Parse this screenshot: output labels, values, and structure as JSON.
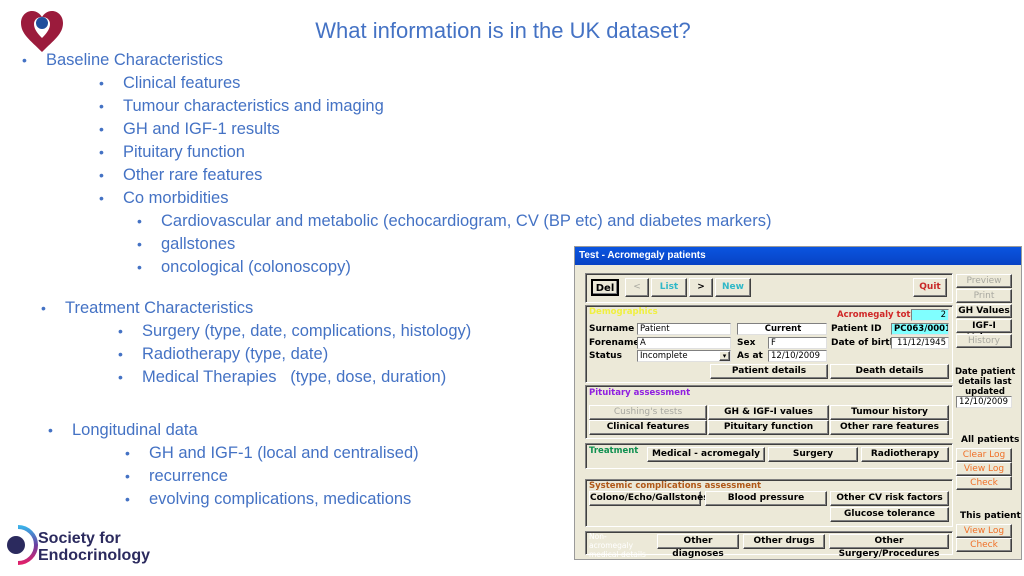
{
  "slide": {
    "title": "What information is in the UK dataset?",
    "logo_icon": "heart-logo-icon",
    "society_logo": {
      "line1": "Society for",
      "line2": "Endocrinology"
    },
    "colors": {
      "text": "#4472c4",
      "heart": "#9b1b3c",
      "heart_dot": "#1f4e9c",
      "society_navy": "#2b2a5e"
    }
  },
  "bullets": {
    "baseline": {
      "label": "Baseline Characteristics",
      "items": [
        "Clinical features",
        "Tumour characteristics and imaging",
        "GH and IGF-1 results",
        "Pituitary function",
        "Other rare features",
        "Co morbidities"
      ],
      "comorbidities": [
        "Cardiovascular and metabolic (echocardiogram, CV (BP etc) and diabetes markers)",
        "gallstones",
        "oncological (colonoscopy)"
      ]
    },
    "treatment": {
      "label": "Treatment Characteristics",
      "items": [
        "Surgery (type, date, complications, histology)",
        "Radiotherapy (type, date)",
        "Medical Therapies   (type, dose, duration)"
      ]
    },
    "longitudinal": {
      "label": "Longitudinal data",
      "items": [
        "GH and IGF-1 (local and centralised)",
        "recurrence",
        "evolving complications, medications"
      ]
    }
  },
  "app": {
    "window_title": "Test - Acromegaly patients",
    "toolbar": {
      "del": "Del",
      "prev": "<",
      "list": "List",
      "next": ">",
      "new": "New",
      "quit": "Quit"
    },
    "side_buttons": {
      "preview": "Preview",
      "print": "Print",
      "gh_values": "GH Values",
      "igf_values": "IGF-I Values",
      "history": "History"
    },
    "demographics": {
      "section": "Demographics",
      "acromegaly_total_label": "Acromegaly total:",
      "acromegaly_total": "2",
      "surname_label": "Surname",
      "surname": "Patient",
      "forename_label": "Forename",
      "forename": "A",
      "status_label": "Status",
      "status": "Incomplete",
      "current": "Current",
      "sex_label": "Sex",
      "sex": "F",
      "as_at_label": "As at",
      "as_at": "12/10/2009",
      "patient_id_label": "Patient ID",
      "patient_id": "PC063/0001",
      "dob_label": "Date of birth",
      "dob": "11/12/1945",
      "patient_details": "Patient details",
      "death_details": "Death details"
    },
    "date_updated": {
      "label1": "Date patient",
      "label2": "details last",
      "label3": "updated",
      "value": "12/10/2009"
    },
    "pituitary": {
      "section": "Pituitary assessment",
      "cushings": "Cushing's tests",
      "gh_igf": "GH & IGF-I values",
      "tumour_history": "Tumour history",
      "clinical_features": "Clinical features",
      "pituitary_function": "Pituitary function",
      "other_rare": "Other rare features"
    },
    "treatment": {
      "section": "Treatment",
      "medical": "Medical - acromegaly",
      "surgery": "Surgery",
      "radiotherapy": "Radiotherapy"
    },
    "systemic": {
      "section": "Systemic complications assessment",
      "colono": "Colono/Echo/Gallstones",
      "bp": "Blood pressure",
      "other_cv": "Other CV risk factors",
      "glucose": "Glucose tolerance"
    },
    "other": {
      "section": "Non-acromegaly medical details",
      "diagnoses": "Other diagnoses",
      "drugs": "Other drugs",
      "surgery": "Other Surgery/Procedures"
    },
    "all_patients": {
      "label": "All patients",
      "clear_log": "Clear Log",
      "view_log": "View Log",
      "check": "Check"
    },
    "this_patient": {
      "label": "This patient",
      "view_log": "View Log",
      "check": "Check"
    }
  }
}
